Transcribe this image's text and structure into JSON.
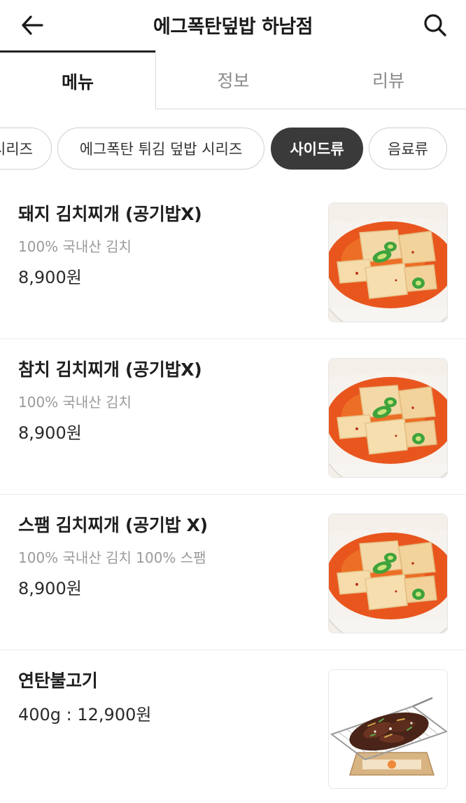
{
  "header": {
    "title": "에그폭탄덮밥 하남점",
    "back_icon": "arrow-left-icon",
    "search_icon": "search-icon"
  },
  "tabs": [
    {
      "label": "메뉴",
      "active": true
    },
    {
      "label": "정보",
      "active": false
    },
    {
      "label": "리뷰",
      "active": false
    }
  ],
  "categories": [
    {
      "label": "시리즈",
      "active": false
    },
    {
      "label": "에그폭탄 튀김 덮밥 시리즈",
      "active": false
    },
    {
      "label": "사이드류",
      "active": true
    },
    {
      "label": "음료류",
      "active": false
    }
  ],
  "menu_items": [
    {
      "name": "돼지 김치찌개 (공기밥X)",
      "description": "100% 국내산 김치",
      "price": "8,900원",
      "image": "kimchi-stew-image"
    },
    {
      "name": "참치 김치찌개 (공기밥X)",
      "description": "100% 국내산 김치",
      "price": "8,900원",
      "image": "kimchi-stew-image"
    },
    {
      "name": "스팸 김치찌개 (공기밥 X)",
      "description": "100% 국내산 김치 100% 스팸",
      "price": "8,900원",
      "image": "kimchi-stew-image"
    },
    {
      "name": "연탄불고기",
      "description": "",
      "price": "400g : 12,900원",
      "image": "grilled-bulgogi-image"
    }
  ],
  "colors": {
    "active_chip_bg": "#3a3a3a",
    "inactive_tab_text": "#8a8a8a",
    "description_text": "#9a9a9a"
  }
}
